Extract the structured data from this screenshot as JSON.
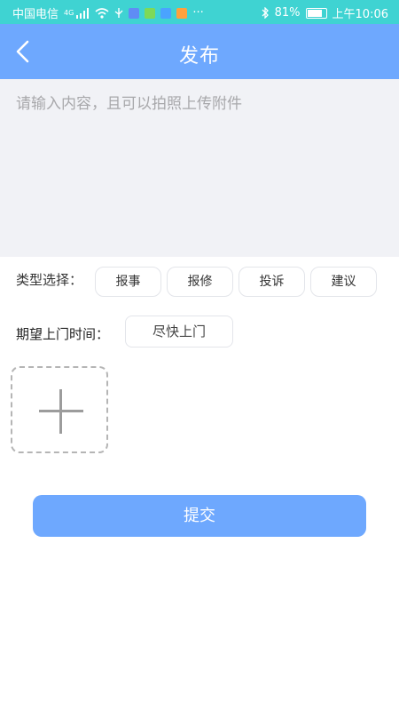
{
  "status_bar": {
    "carrier": "中国电信",
    "network": "4G",
    "more": "···",
    "battery_percent": "81%",
    "time": "上午10:06",
    "icons": [
      "signal-icon",
      "wifi-icon",
      "usb-icon",
      "app-icon-1",
      "app-icon-2",
      "app-icon-3",
      "bluetooth-icon",
      "battery-icon"
    ],
    "colors": {
      "bar": "#3fd3d2"
    }
  },
  "nav": {
    "title": "发布",
    "back_icon": "chevron-left-icon",
    "color": "#6ea8fe"
  },
  "content_input": {
    "placeholder": "请输入内容，且可以拍照上传附件",
    "value": ""
  },
  "type_select": {
    "label": "类型选择：",
    "options": [
      {
        "label": "报事"
      },
      {
        "label": "报修"
      },
      {
        "label": "投诉"
      },
      {
        "label": "建议"
      }
    ]
  },
  "visit_time": {
    "label": "期望上门时间：",
    "value": "尽快上门"
  },
  "upload": {
    "icon": "plus-icon"
  },
  "submit": {
    "label": "提交",
    "color": "#6ea8fe"
  }
}
